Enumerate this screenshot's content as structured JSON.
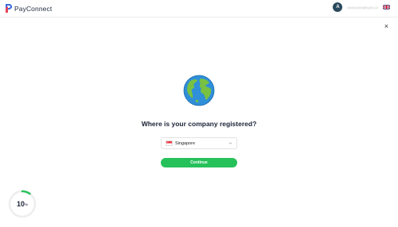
{
  "header": {
    "logo_text": "PayConnect",
    "avatar_initial": "A",
    "user_email": "andrew.lim@hydro.co",
    "language_flag": "uk-flag"
  },
  "close_label": "×",
  "question": "Where is your company registered?",
  "country_select": {
    "flag": "singapore-flag",
    "value": "Singapore"
  },
  "continue_label": "Continue",
  "progress": {
    "value": 10,
    "unit": "%",
    "color": "#26c15a"
  },
  "colors": {
    "brand": "#26c15a",
    "text": "#1a2236"
  }
}
